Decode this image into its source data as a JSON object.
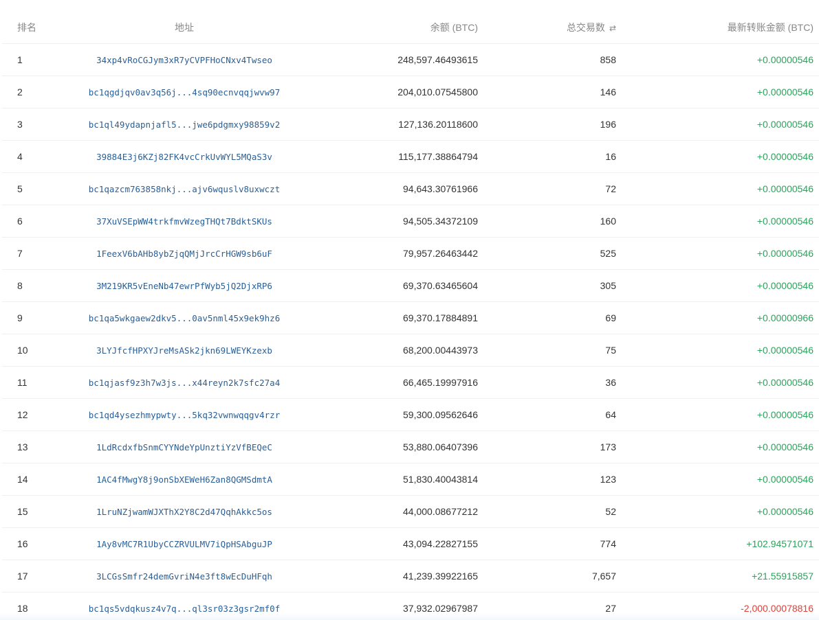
{
  "header": {
    "rank": "排名",
    "address": "地址",
    "balance": "余额 (BTC)",
    "tx_count": "总交易数",
    "sort_icon": "⇄",
    "last_transfer": "最新转账金额 (BTC)"
  },
  "rows": [
    {
      "rank": "1",
      "address": "34xp4vRoCGJym3xR7yCVPFHoCNxv4Twseo",
      "balance": "248,597.46493615",
      "tx": "858",
      "last": "+0.00000546",
      "sign": "pos"
    },
    {
      "rank": "2",
      "address": "bc1qgdjqv0av3q56j...4sq90ecnvqqjwvw97",
      "balance": "204,010.07545800",
      "tx": "146",
      "last": "+0.00000546",
      "sign": "pos"
    },
    {
      "rank": "3",
      "address": "bc1ql49ydapnjafl5...jwe6pdgmxy98859v2",
      "balance": "127,136.20118600",
      "tx": "196",
      "last": "+0.00000546",
      "sign": "pos"
    },
    {
      "rank": "4",
      "address": "39884E3j6KZj82FK4vcCrkUvWYL5MQaS3v",
      "balance": "115,177.38864794",
      "tx": "16",
      "last": "+0.00000546",
      "sign": "pos"
    },
    {
      "rank": "5",
      "address": "bc1qazcm763858nkj...ajv6wquslv8uxwczt",
      "balance": "94,643.30761966",
      "tx": "72",
      "last": "+0.00000546",
      "sign": "pos"
    },
    {
      "rank": "6",
      "address": "37XuVSEpWW4trkfmvWzegTHQt7BdktSKUs",
      "balance": "94,505.34372109",
      "tx": "160",
      "last": "+0.00000546",
      "sign": "pos"
    },
    {
      "rank": "7",
      "address": "1FeexV6bAHb8ybZjqQMjJrcCrHGW9sb6uF",
      "balance": "79,957.26463442",
      "tx": "525",
      "last": "+0.00000546",
      "sign": "pos"
    },
    {
      "rank": "8",
      "address": "3M219KR5vEneNb47ewrPfWyb5jQ2DjxRP6",
      "balance": "69,370.63465604",
      "tx": "305",
      "last": "+0.00000546",
      "sign": "pos"
    },
    {
      "rank": "9",
      "address": "bc1qa5wkgaew2dkv5...0av5nml45x9ek9hz6",
      "balance": "69,370.17884891",
      "tx": "69",
      "last": "+0.00000966",
      "sign": "pos"
    },
    {
      "rank": "10",
      "address": "3LYJfcfHPXYJreMsASk2jkn69LWEYKzexb",
      "balance": "68,200.00443973",
      "tx": "75",
      "last": "+0.00000546",
      "sign": "pos"
    },
    {
      "rank": "11",
      "address": "bc1qjasf9z3h7w3js...x44reyn2k7sfc27a4",
      "balance": "66,465.19997916",
      "tx": "36",
      "last": "+0.00000546",
      "sign": "pos"
    },
    {
      "rank": "12",
      "address": "bc1qd4ysezhmypwty...5kq32vwnwqqgv4rzr",
      "balance": "59,300.09562646",
      "tx": "64",
      "last": "+0.00000546",
      "sign": "pos"
    },
    {
      "rank": "13",
      "address": "1LdRcdxfbSnmCYYNdeYpUnztiYzVfBEQeC",
      "balance": "53,880.06407396",
      "tx": "173",
      "last": "+0.00000546",
      "sign": "pos"
    },
    {
      "rank": "14",
      "address": "1AC4fMwgY8j9onSbXEWeH6Zan8QGMSdmtA",
      "balance": "51,830.40043814",
      "tx": "123",
      "last": "+0.00000546",
      "sign": "pos"
    },
    {
      "rank": "15",
      "address": "1LruNZjwamWJXThX2Y8C2d47QqhAkkc5os",
      "balance": "44,000.08677212",
      "tx": "52",
      "last": "+0.00000546",
      "sign": "pos"
    },
    {
      "rank": "16",
      "address": "1Ay8vMC7R1UbyCCZRVULMV7iQpHSAbguJP",
      "balance": "43,094.22827155",
      "tx": "774",
      "last": "+102.94571071",
      "sign": "pos"
    },
    {
      "rank": "17",
      "address": "3LCGsSmfr24demGvriN4e3ft8wEcDuHFqh",
      "balance": "41,239.39922165",
      "tx": "7,657",
      "last": "+21.55915857",
      "sign": "pos"
    },
    {
      "rank": "18",
      "address": "bc1qs5vdqkusz4v7q...ql3sr03z3gsr2mf0f",
      "balance": "37,932.02967987",
      "tx": "27",
      "last": "-2,000.00078816",
      "sign": "neg"
    }
  ],
  "colors": {
    "positive": "#2aa35a",
    "negative": "#e0403a",
    "link": "#2a5f96",
    "header_text": "#888888"
  }
}
